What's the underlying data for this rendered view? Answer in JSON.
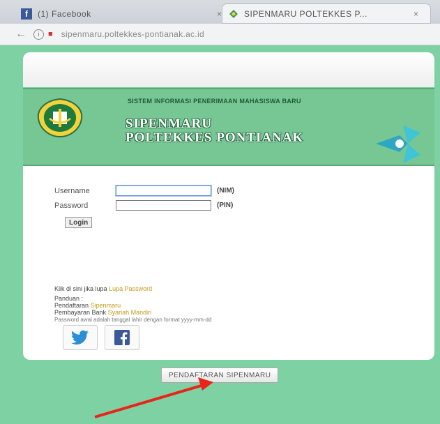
{
  "browser": {
    "tabs": [
      {
        "title": "(1) Facebook",
        "icon": "facebook-icon",
        "close": "×"
      },
      {
        "title": "SIPENMARU POLTEKKES P...",
        "icon": "site-icon",
        "close": "×"
      }
    ],
    "url": "sipenmaru.poltekkes-pontianak.ac.id"
  },
  "banner": {
    "subtitle": "SISTEM INFORMASI PENERIMAAN MAHASISWA BARU",
    "title_line1": "SIPENMARU",
    "title_line2": "POLTEKKES PONTIANAK"
  },
  "login": {
    "username_label": "Username",
    "password_label": "Password",
    "username_hint": "(NIM)",
    "password_hint": "(PIN)",
    "username_value": "",
    "password_value": "",
    "login_button": "Login"
  },
  "help": {
    "lupa_prefix": "Klik di sini jika lupa",
    "lupa_link": "Lupa Password",
    "panduan_label": "Panduan :",
    "pendaftaran_prefix": "Pendaftaran",
    "pendaftaran_link": "Sipenmaru",
    "pembayaran_prefix": "Pembayaran Bank",
    "pembayaran_link": "Syariah Mandiri",
    "password_note": "Password awal adalah tanggal lahir dengan format yyyy-mm-dd"
  },
  "social": {
    "twitter": "twitter-icon",
    "facebook": "facebook-icon"
  },
  "register_button": "PENDAFTARAN SIPENMARU",
  "colors": {
    "page_background": "#7dd1a2",
    "banner": "#77c794",
    "link": "#c59a1c",
    "annotation_arrow": "#e8241b"
  }
}
